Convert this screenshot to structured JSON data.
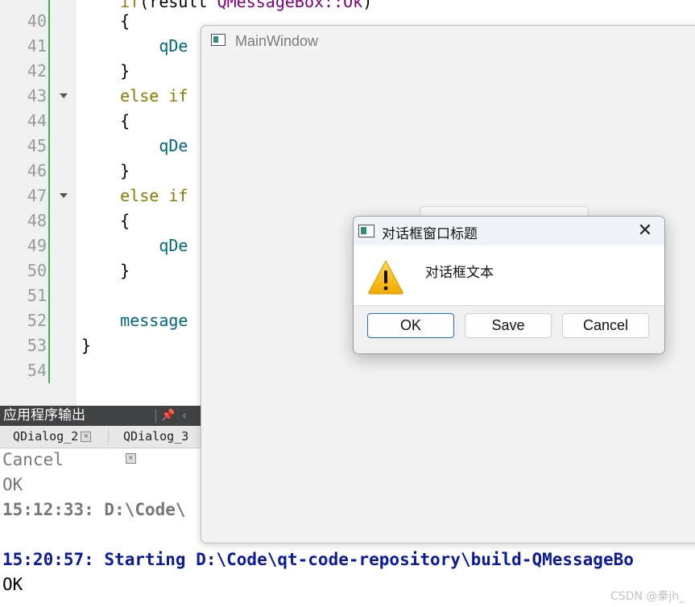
{
  "editor": {
    "lines": [
      {
        "no": "40",
        "code": "    {"
      },
      {
        "no": "41",
        "code": "        qDe"
      },
      {
        "no": "42",
        "code": "    }"
      },
      {
        "no": "43",
        "code": "    else if"
      },
      {
        "no": "44",
        "code": "    {"
      },
      {
        "no": "45",
        "code": "        qDe"
      },
      {
        "no": "46",
        "code": "    }"
      },
      {
        "no": "47",
        "code": "    else if"
      },
      {
        "no": "48",
        "code": "    {"
      },
      {
        "no": "49",
        "code": "        qDe"
      },
      {
        "no": "50",
        "code": "    }"
      },
      {
        "no": "51",
        "code": ""
      },
      {
        "no": "52",
        "code": "    message"
      },
      {
        "no": "53",
        "code": "}"
      },
      {
        "no": "54",
        "code": ""
      }
    ]
  },
  "output_pane": {
    "title": "应用程序输出",
    "tabs": [
      {
        "label": "QDialog_2"
      },
      {
        "label": "QDialog_3"
      }
    ],
    "lines": [
      {
        "text": "Cancel",
        "style": "gray"
      },
      {
        "text": "OK",
        "style": "gray"
      },
      {
        "text": "15:12:33: D:\\Code\\",
        "style": "bold-gray"
      },
      {
        "text": "",
        "style": "gray"
      },
      {
        "text": "15:20:57: Starting D:\\Code\\qt-code-repository\\build-QMessageBo",
        "style": "bold-blue"
      },
      {
        "text": "OK",
        "style": "black"
      }
    ]
  },
  "main_window": {
    "title": "MainWindow"
  },
  "dialog": {
    "title": "对话框窗口标题",
    "text": "对话框文本",
    "icon": "warning-icon",
    "buttons": [
      {
        "label": "OK",
        "default": true
      },
      {
        "label": "Save",
        "default": false
      },
      {
        "label": "Cancel",
        "default": false
      }
    ]
  },
  "watermark": "CSDN @秦jh_",
  "colors": {
    "keyword": "#808000",
    "function": "#00677c",
    "change_bar": "#3fb24f",
    "output_blue": "#0b1a9c",
    "default_button_border": "#1f6fc4"
  }
}
